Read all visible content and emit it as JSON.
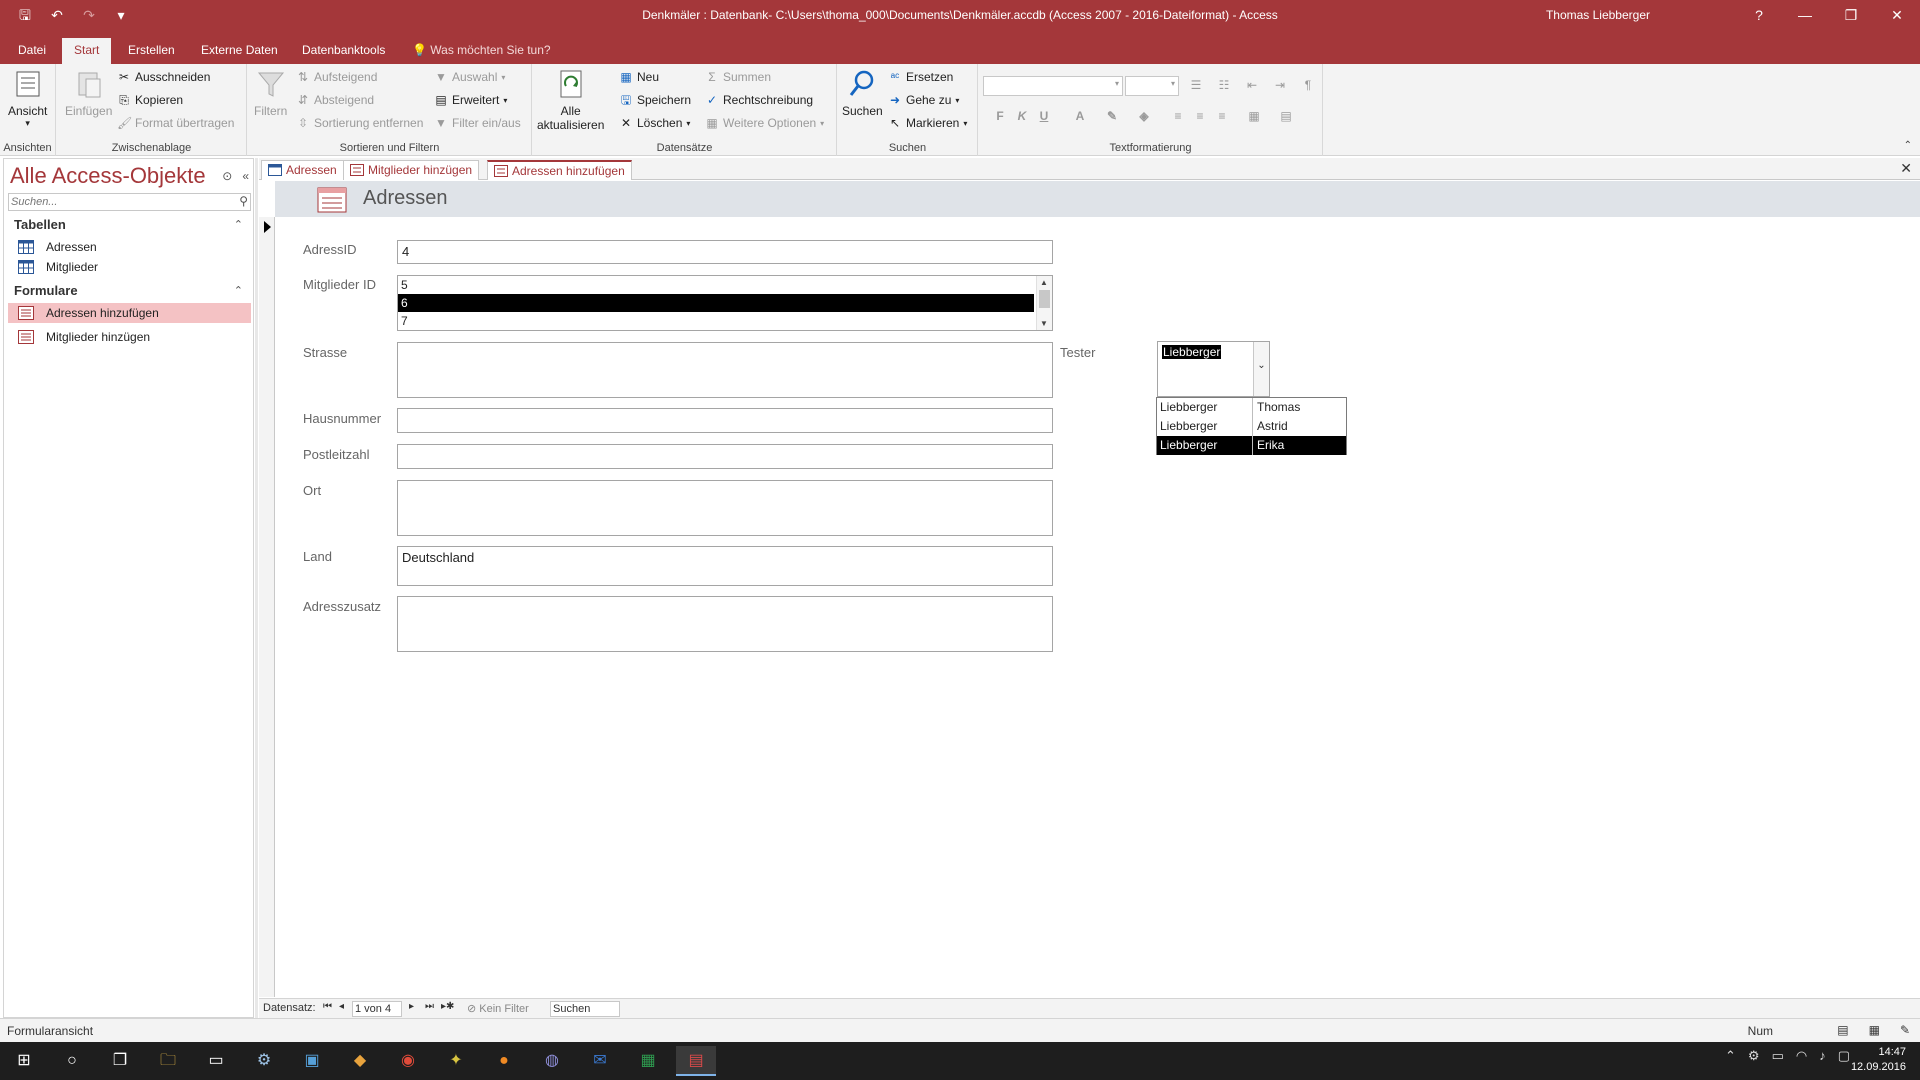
{
  "window": {
    "title": "Denkmäler : Datenbank- C:\\Users\\thoma_000\\Documents\\Denkmäler.accdb (Access 2007 - 2016-Dateiformat) - Access",
    "user": "Thomas Liebberger",
    "help": "?",
    "minimize": "—",
    "restore": "❐",
    "close": "✕"
  },
  "ribbon_tabs": [
    "Datei",
    "Start",
    "Erstellen",
    "Externe Daten",
    "Datenbanktools"
  ],
  "tell_me": "Was möchten Sie tun?",
  "ribbon": {
    "ansichten": {
      "label": "Ansichten",
      "view": "Ansicht"
    },
    "zwischenablage": {
      "label": "Zwischenablage",
      "paste": "Einfügen",
      "cut": "Ausschneiden",
      "copy": "Kopieren",
      "format": "Format übertragen"
    },
    "sortieren": {
      "label": "Sortieren und Filtern",
      "filter": "Filtern",
      "asc": "Aufsteigend",
      "desc": "Absteigend",
      "remove_sort": "Sortierung entfernen",
      "selection": "Auswahl",
      "advanced": "Erweitert",
      "toggle": "Filter ein/aus"
    },
    "datensaetze": {
      "label": "Datensätze",
      "refresh_1": "Alle",
      "refresh_2": "aktualisieren",
      "new": "Neu",
      "save": "Speichern",
      "delete": "Löschen",
      "totals": "Summen",
      "spelling": "Rechtschreibung",
      "more": "Weitere Optionen"
    },
    "suchen": {
      "label": "Suchen",
      "find": "Suchen",
      "replace": "Ersetzen",
      "goto": "Gehe zu",
      "select": "Markieren"
    },
    "text": {
      "label": "Textformatierung",
      "bold": "F",
      "italic": "K",
      "underline": "U",
      "fontcolor": "A"
    }
  },
  "nav": {
    "title": "Alle Access-Objekte",
    "search_placeholder": "Suchen...",
    "groups": [
      {
        "label": "Tabellen",
        "items": [
          "Adressen",
          "Mitglieder"
        ]
      },
      {
        "label": "Formulare",
        "items": [
          "Adressen hinzufügen",
          "Mitglieder hinzügen"
        ]
      }
    ]
  },
  "doc_tabs": [
    "Adressen",
    "Mitglieder hinzügen",
    "Adressen hinzufügen"
  ],
  "form": {
    "title": "Adressen",
    "labels": {
      "adressid": "AdressID",
      "mitglieder_id": "Mitglieder ID",
      "strasse": "Strasse",
      "hausnummer": "Hausnummer",
      "postleitzahl": "Postleitzahl",
      "ort": "Ort",
      "land": "Land",
      "adresszusatz": "Adresszusatz",
      "tester": "Tester"
    },
    "values": {
      "adressid": "4",
      "strasse": "",
      "hausnummer": "",
      "postleitzahl": "",
      "ort": "",
      "land": "Deutschland",
      "adresszusatz": ""
    },
    "mitglieder_options": [
      "5",
      "6",
      "7"
    ],
    "mitglieder_selected": "6",
    "tester_value": "Liebberger",
    "tester_rows": [
      {
        "last": "Liebberger",
        "first": "Thomas"
      },
      {
        "last": "Liebberger",
        "first": "Astrid"
      },
      {
        "last": "Liebberger",
        "first": "Erika"
      }
    ]
  },
  "recnav": {
    "label": "Datensatz:",
    "position": "1 von 4",
    "filter": "Kein Filter",
    "search": "Suchen"
  },
  "status": {
    "left": "Formularansicht",
    "num": "Num"
  },
  "taskbar": {
    "time": "14:47",
    "date": "12.09.2016"
  }
}
